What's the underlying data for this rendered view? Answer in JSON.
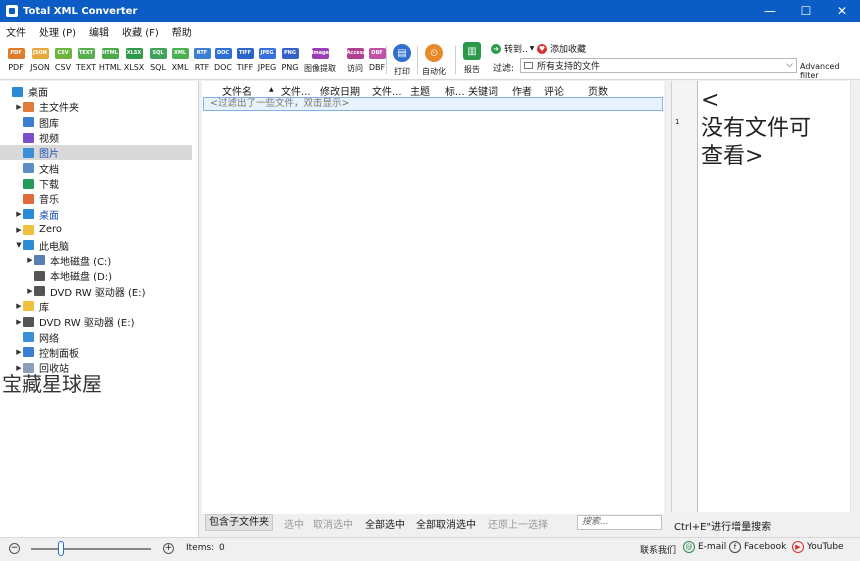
{
  "window": {
    "title": "Total XML Converter",
    "minimize": "—",
    "maximize": "☐",
    "close": "✕"
  },
  "menu": [
    "文件",
    "处理 (P)",
    "编辑",
    "收藏 (F)",
    "帮助"
  ],
  "toolbar": {
    "formats": [
      {
        "label": "PDF",
        "icon_text": "PDF",
        "color": "#e07b2a"
      },
      {
        "label": "JSON",
        "icon_text": "JSON",
        "color": "#e5a83a"
      },
      {
        "label": "CSV",
        "icon_text": "CSV",
        "color": "#6cb33f"
      },
      {
        "label": "TEXT",
        "icon_text": "TEXT",
        "color": "#57b04f"
      },
      {
        "label": "HTML",
        "icon_text": "HTML",
        "color": "#4da84a"
      },
      {
        "label": "XLSX",
        "icon_text": "XLSX",
        "color": "#2f9a4a"
      },
      {
        "label": "SQL",
        "icon_text": "SQL",
        "color": "#3fa45a"
      },
      {
        "label": "XML",
        "icon_text": "XML",
        "color": "#4caf50"
      },
      {
        "label": "RTF",
        "icon_text": "RTF",
        "color": "#3a7fd0"
      },
      {
        "label": "DOC",
        "icon_text": "DOC",
        "color": "#2e6fd0"
      },
      {
        "label": "TIFF",
        "icon_text": "TIFF",
        "color": "#2b63c9"
      },
      {
        "label": "JPEG",
        "icon_text": "JPEG",
        "color": "#3a6fd8"
      },
      {
        "label": "PNG",
        "icon_text": "PNG",
        "color": "#3460c8"
      },
      {
        "label": "图像提取",
        "icon_text": "Image",
        "color": "#9b3fb8"
      },
      {
        "label": "访问",
        "icon_text": "Access",
        "color": "#b04090"
      },
      {
        "label": "DBF",
        "icon_text": "DBF",
        "color": "#c050a8"
      }
    ],
    "print_label": "打印",
    "auto_label": "自动化",
    "report_label": "报告",
    "goto_label": "转到..",
    "favorites_label": "添加收藏",
    "filter_label": "过滤:",
    "filter_value": "所有支持的文件",
    "advanced_filter": "Advanced filter"
  },
  "tree": [
    {
      "label": "桌面",
      "indent": 0,
      "arrow": "",
      "icon_color": "#2a8bd6",
      "blue": false,
      "selected": false
    },
    {
      "label": "主文件夹",
      "indent": 1,
      "arrow": "▶",
      "icon_color": "#e07b3a",
      "blue": false,
      "selected": false
    },
    {
      "label": "图库",
      "indent": 1,
      "arrow": "",
      "icon_color": "#3a7fd0",
      "blue": false,
      "selected": false
    },
    {
      "label": "视频",
      "indent": 1,
      "arrow": "",
      "icon_color": "#7b4fc8",
      "blue": false,
      "selected": false
    },
    {
      "label": "图片",
      "indent": 1,
      "arrow": "",
      "icon_color": "#3a8fd6",
      "blue": true,
      "selected": true
    },
    {
      "label": "文档",
      "indent": 1,
      "arrow": "",
      "icon_color": "#5a8fc8",
      "blue": false,
      "selected": false
    },
    {
      "label": "下载",
      "indent": 1,
      "arrow": "",
      "icon_color": "#2a9a5a",
      "blue": false,
      "selected": false
    },
    {
      "label": "音乐",
      "indent": 1,
      "arrow": "",
      "icon_color": "#e06a3a",
      "blue": false,
      "selected": false
    },
    {
      "label": "桌面",
      "indent": 1,
      "arrow": "▶",
      "icon_color": "#2a8bd6",
      "blue": true,
      "selected": false
    },
    {
      "label": "Zero",
      "indent": 1,
      "arrow": "▶",
      "icon_color": "#f0c040",
      "blue": false,
      "selected": false
    },
    {
      "label": "此电脑",
      "indent": 1,
      "arrow": "▼",
      "icon_color": "#2a8bd6",
      "blue": false,
      "selected": false
    },
    {
      "label": "本地磁盘 (C:)",
      "indent": 2,
      "arrow": "▶",
      "icon_color": "#5a7fb0",
      "blue": false,
      "selected": false
    },
    {
      "label": "本地磁盘 (D:)",
      "indent": 2,
      "arrow": "",
      "icon_color": "#555555",
      "blue": false,
      "selected": false
    },
    {
      "label": "DVD RW 驱动器 (E:)",
      "indent": 2,
      "arrow": "▶",
      "icon_color": "#555555",
      "blue": false,
      "selected": false
    },
    {
      "label": "库",
      "indent": 1,
      "arrow": "▶",
      "icon_color": "#f0c040",
      "blue": false,
      "selected": false
    },
    {
      "label": "DVD RW 驱动器 (E:)",
      "indent": 1,
      "arrow": "▶",
      "icon_color": "#555555",
      "blue": false,
      "selected": false
    },
    {
      "label": "网络",
      "indent": 1,
      "arrow": "",
      "icon_color": "#3a8fd6",
      "blue": false,
      "selected": false
    },
    {
      "label": "控制面板",
      "indent": 1,
      "arrow": "▶",
      "icon_color": "#3a7fd0",
      "blue": false,
      "selected": false
    },
    {
      "label": "回收站",
      "indent": 1,
      "arrow": "▶",
      "icon_color": "#8aa0b8",
      "blue": false,
      "selected": false
    }
  ],
  "watermark_left": "宝藏星球屋",
  "columns": [
    "文件名",
    "文件...",
    "修改日期",
    "文件...",
    "主题",
    "标...",
    "关键词",
    "作者",
    "评论",
    "页数"
  ],
  "notice": "<过滤出了一些文件，双击显示>",
  "bottom": {
    "include_subfolders": "包含子文件夹",
    "select": "选中",
    "deselect": "取消选中",
    "select_all": "全部选中",
    "deselect_all": "全部取消选中",
    "restore": "还原上一选择",
    "search_placeholder": "搜索..."
  },
  "preview": {
    "line_number": "1",
    "text": "<\n没有文件可\n查看>",
    "hint": "Ctrl+E\"进行增量搜索"
  },
  "status": {
    "items_label": "Items:",
    "items_count": "0",
    "contact": "联系我们",
    "email": "E-mail",
    "facebook": "Facebook",
    "youtube": "YouTube",
    "zoom_minus": "−",
    "zoom_plus": "+"
  }
}
